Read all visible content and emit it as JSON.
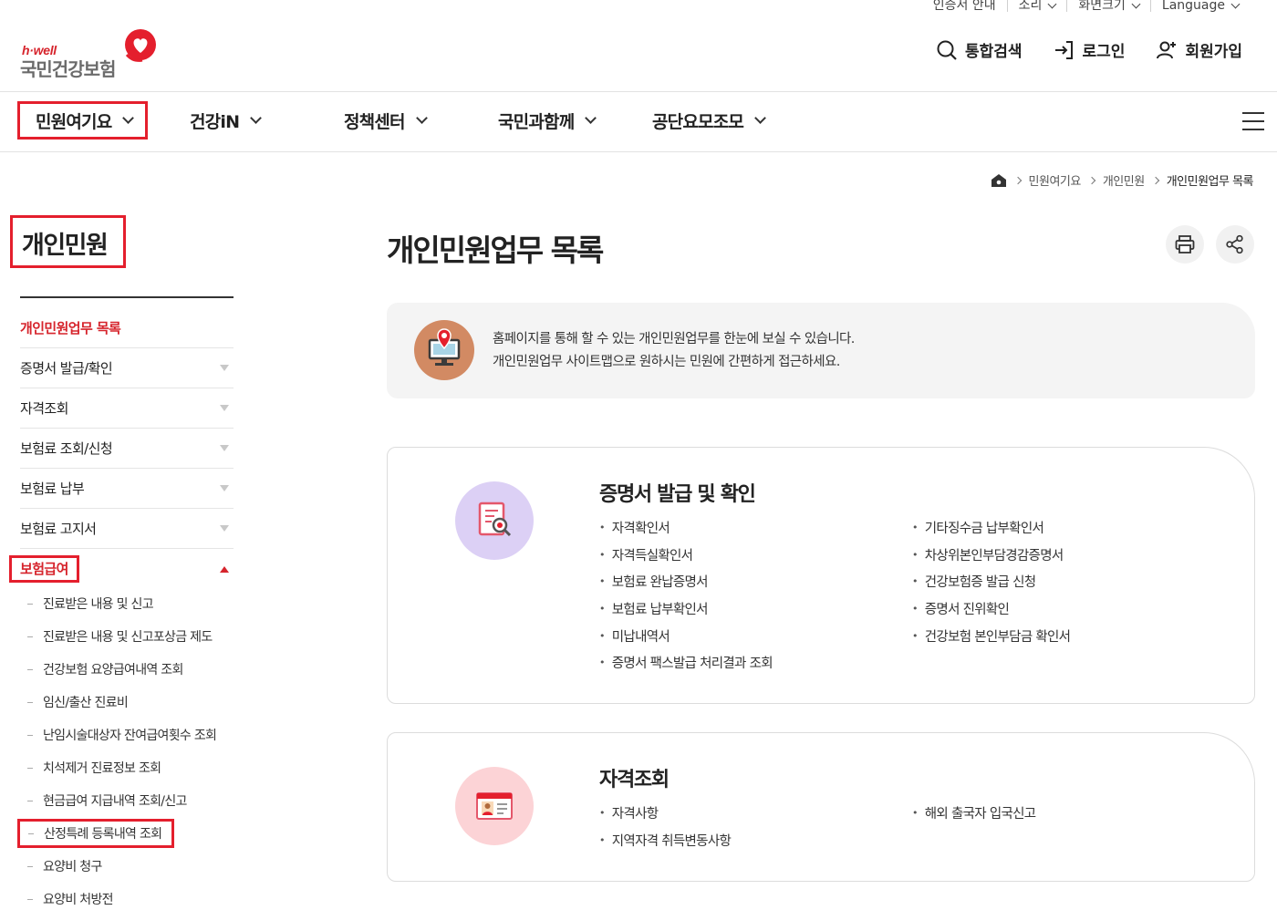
{
  "utility": {
    "items": [
      "인증서 안내",
      "소리",
      "화면크기",
      "Language"
    ]
  },
  "logo": {
    "brand": "h·well",
    "name": "국민건강보험"
  },
  "actions": {
    "search": "통합검색",
    "login": "로그인",
    "join": "회원가입"
  },
  "gnb": {
    "menus": [
      "민원여기요",
      "건강iN",
      "정책센터",
      "국민과함께",
      "공단요모조모"
    ]
  },
  "breadcrumb": {
    "items": [
      "민원여기요",
      "개인민원",
      "개인민원업무 목록"
    ]
  },
  "sidebar": {
    "title": "개인민원",
    "items": [
      {
        "label": "개인민원업무 목록"
      },
      {
        "label": "증명서 발급/확인"
      },
      {
        "label": "자격조회"
      },
      {
        "label": "보험료 조회/신청"
      },
      {
        "label": "보험료 납부"
      },
      {
        "label": "보험료 고지서"
      },
      {
        "label": "보험급여"
      }
    ],
    "subitems": [
      "진료받은 내용 및 신고",
      "진료받은 내용 및 신고포상금 제도",
      "건강보험 요양급여내역 조회",
      "임신/출산 진료비",
      "난임시술대상자 잔여급여횟수 조회",
      "치석제거 진료정보 조회",
      "현금급여 지급내역 조회/신고",
      "산정특례 등록내역 조회",
      "요양비 청구",
      "요양비 처방전"
    ]
  },
  "main": {
    "title": "개인민원업무 목록",
    "intro": {
      "line1": "홈페이지를 통해 할 수 있는 개인민원업무를 한눈에 보실 수 있습니다.",
      "line2": "개인민원업무 사이트맵으로 원하시는 민원에 간편하게 접근하세요."
    },
    "cards": [
      {
        "title": "증명서 발급 및 확인",
        "left": [
          "자격확인서",
          "자격득실확인서",
          "보험료 완납증명서",
          "보험료 납부확인서",
          "미납내역서",
          "증명서 팩스발급 처리결과 조회"
        ],
        "right": [
          "기타징수금 납부확인서",
          "차상위본인부담경감증명서",
          "건강보험증 발급 신청",
          "증명서 진위확인",
          "건강보험 본인부담금 확인서"
        ]
      },
      {
        "title": "자격조회",
        "left": [
          "자격사항",
          "지역자격 취득변동사항"
        ],
        "right": [
          "해외 출국자 입국신고"
        ]
      }
    ]
  },
  "colors": {
    "accent": "#d6242c",
    "highlight_box": "#e41f2d",
    "card1_icon_bg": "#dcd0f5",
    "card2_icon_bg": "#fcd3d6",
    "intro_icon_bg": "#d28a63"
  }
}
